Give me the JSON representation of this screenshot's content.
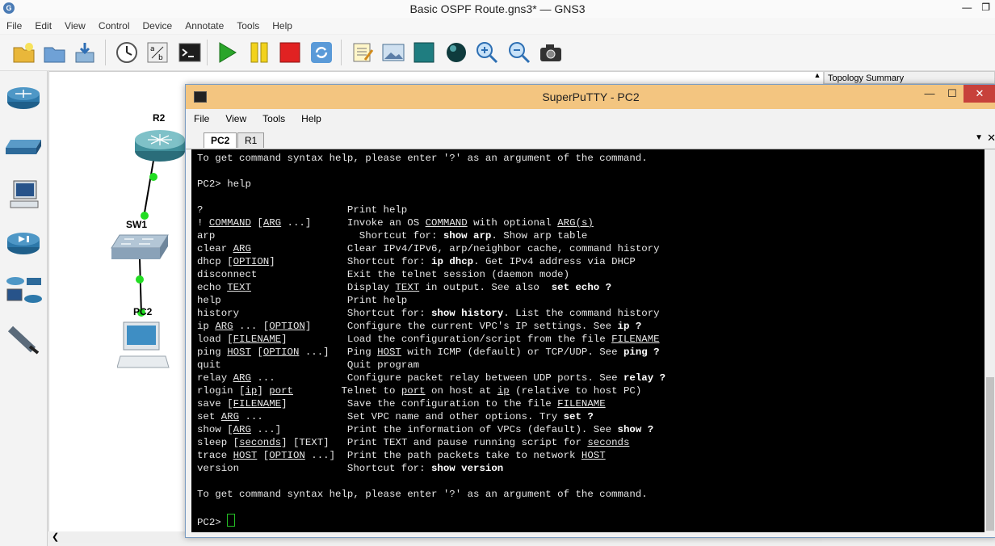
{
  "window": {
    "title": "Basic OSPF Route.gns3* — GNS3"
  },
  "menu": [
    "File",
    "Edit",
    "View",
    "Control",
    "Device",
    "Annotate",
    "Tools",
    "Help"
  ],
  "topology_summary": "Topology Summary",
  "nodes": {
    "r2": "R2",
    "sw1": "SW1",
    "pc2": "PC2"
  },
  "putty": {
    "title": "SuperPuTTY - PC2",
    "menu": [
      "File",
      "View",
      "Tools",
      "Help"
    ],
    "tabs": [
      "PC2",
      "R1"
    ]
  },
  "terminal": {
    "syntax_help": "To get command syntax help, please enter '?' as an argument of the command.",
    "prompt": "PC2> ",
    "command": "help"
  }
}
